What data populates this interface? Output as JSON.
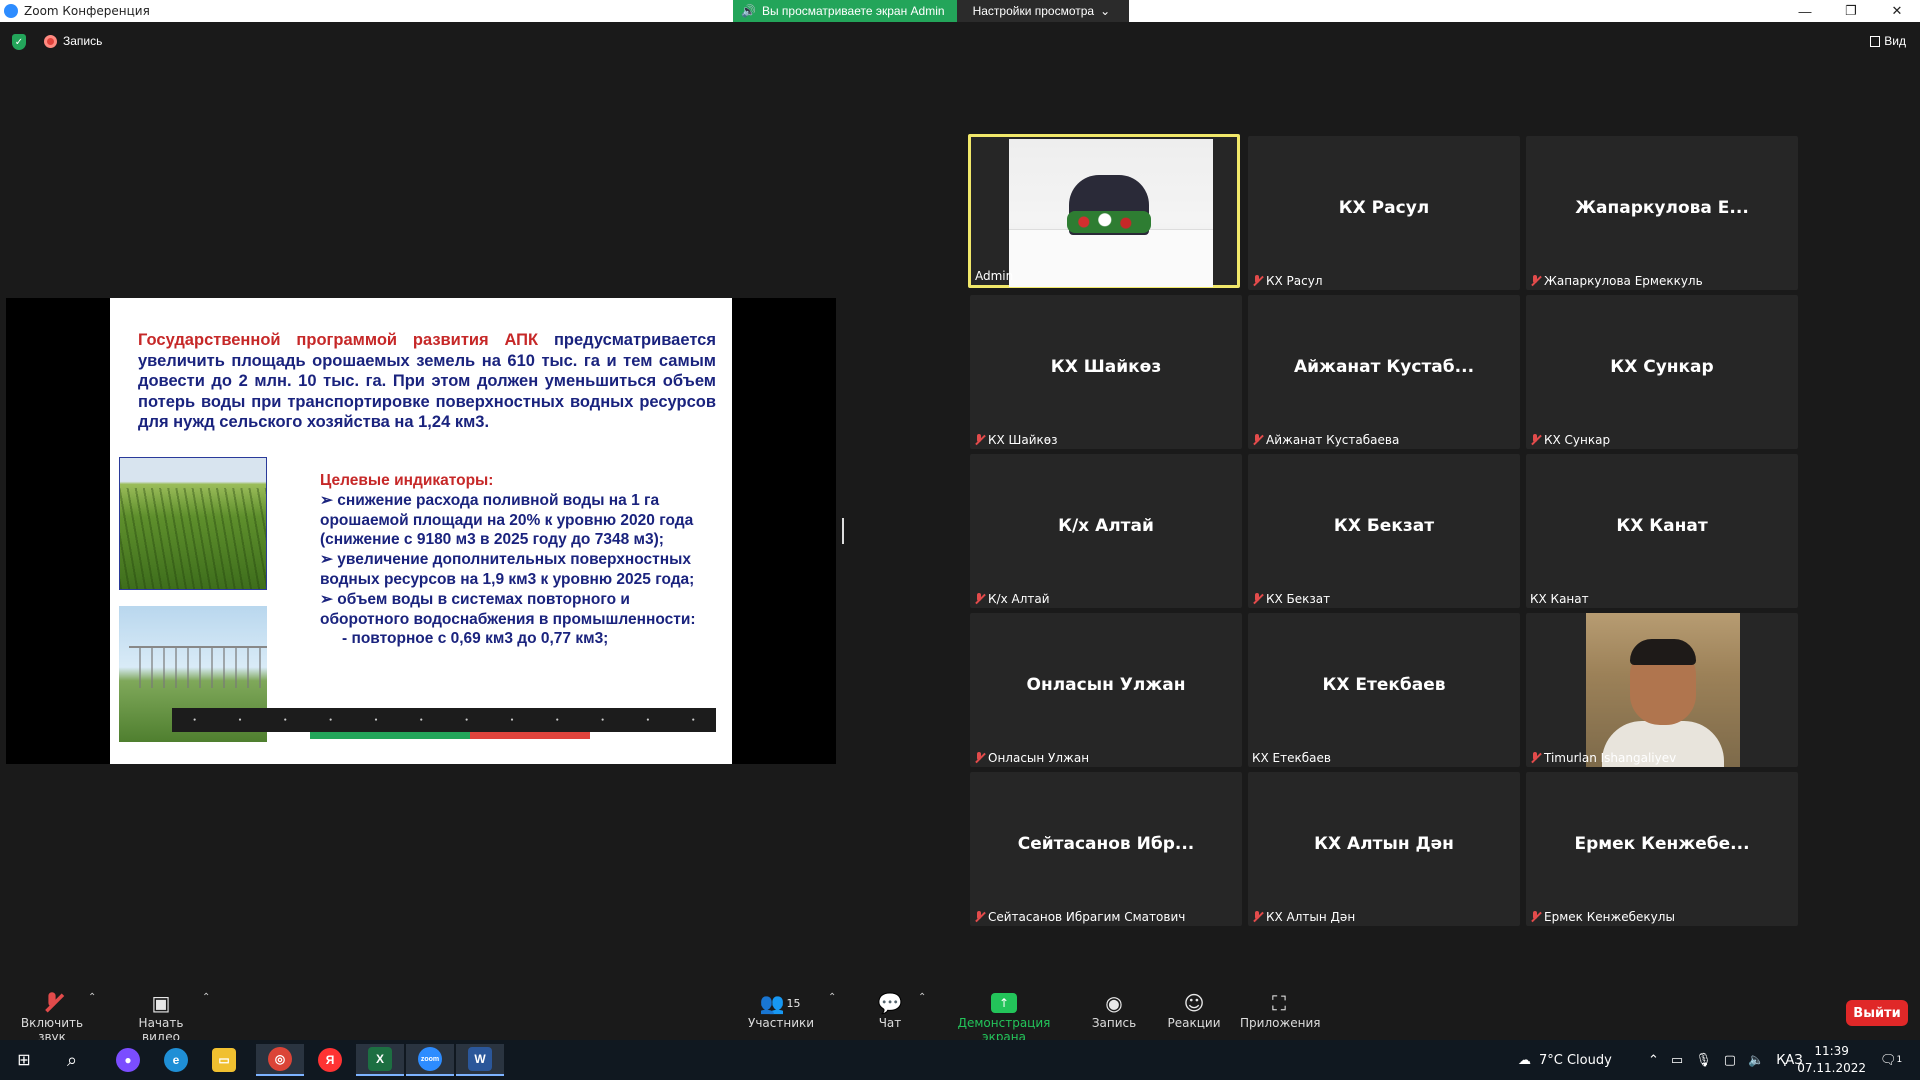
{
  "window": {
    "title": "Zoom Конференция"
  },
  "share_banner": {
    "viewing": "Вы просматриваете экран Admin",
    "settings": "Настройки просмотра"
  },
  "status": {
    "recording": "Запись",
    "view": "Вид"
  },
  "slide": {
    "heading_red": "Государственной программой развития АПК",
    "heading_body": "предусматривается увеличить площадь орошаемых земель на 610 тыс. га и тем самым довести до 2 млн. 10 тыс. га. При этом должен уменьшиться объем потерь воды при транспортировке поверхностных водных ресурсов для нужд сельского хозяйства на 1,24 км3.",
    "targets_title": "Целевые индикаторы:",
    "targets": [
      "➢ снижение расхода поливной воды на 1 га орошаемой площади на 20% к уровню 2020 года (снижение с 9180 м3 в 2025 году до 7348 м3);",
      "➢ увеличение дополнительных поверхностных водных ресурсов на 1,9 км3 к уровню 2025 года;",
      "➢ объем воды в системах повторного и оборотного водоснабжения в промышленности:",
      "- повторное с 0,69 км3 до 0,77 км3;"
    ]
  },
  "participants": [
    {
      "big": "",
      "name": "Admin",
      "muted": false,
      "video": "admin"
    },
    {
      "big": "КХ Расул",
      "name": "КХ Расул",
      "muted": true
    },
    {
      "big": "Жапаркулова Е...",
      "name": "Жапаркулова Ермеккуль",
      "muted": true
    },
    {
      "big": "КХ Шайкөз",
      "name": "КХ Шайкөз",
      "muted": true
    },
    {
      "big": "Айжанат Кустаб...",
      "name": "Айжанат Кустабаева",
      "muted": true
    },
    {
      "big": "КХ Сункар",
      "name": "КХ Сункар",
      "muted": true
    },
    {
      "big": "К/х Алтай",
      "name": "К/х Алтай",
      "muted": true
    },
    {
      "big": "КХ Бекзат",
      "name": "КХ Бекзат",
      "muted": true
    },
    {
      "big": "КХ Канат",
      "name": "КХ Канат",
      "muted": false
    },
    {
      "big": "Онласын Улжан",
      "name": "Онласын Улжан",
      "muted": true
    },
    {
      "big": "КХ Етекбаев",
      "name": "КХ Етекбаев",
      "muted": false
    },
    {
      "big": "",
      "name": "Timurlan Ishangaliyev",
      "muted": true,
      "video": "timurlan"
    },
    {
      "big": "Сейтасанов Ибр...",
      "name": "Сейтасанов Ибрагим Сматович",
      "muted": true
    },
    {
      "big": "КХ Алтын Дән",
      "name": "КХ Алтын Дән",
      "muted": true
    },
    {
      "big": "Ермек Кенжебе...",
      "name": "Ермек Кенжебекулы",
      "muted": true
    }
  ],
  "toolbar": {
    "unmute": "Включить звук",
    "start_video": "Начать видео",
    "participants": "Участники",
    "participants_count": "15",
    "chat": "Чат",
    "share": "Демонстрация экрана",
    "record": "Запись",
    "reactions": "Реакции",
    "apps": "Приложения",
    "leave": "Выйти"
  },
  "taskbar": {
    "weather": "7°C Cloudy",
    "lang": "ҚАЗ",
    "time": "11:39",
    "date": "07.11.2022",
    "notifications": "1"
  },
  "colors": {
    "share_green": "#23a55a",
    "active_border": "#f1e86a",
    "leave_red": "#e02828",
    "mute_red": "#e24b4b"
  }
}
